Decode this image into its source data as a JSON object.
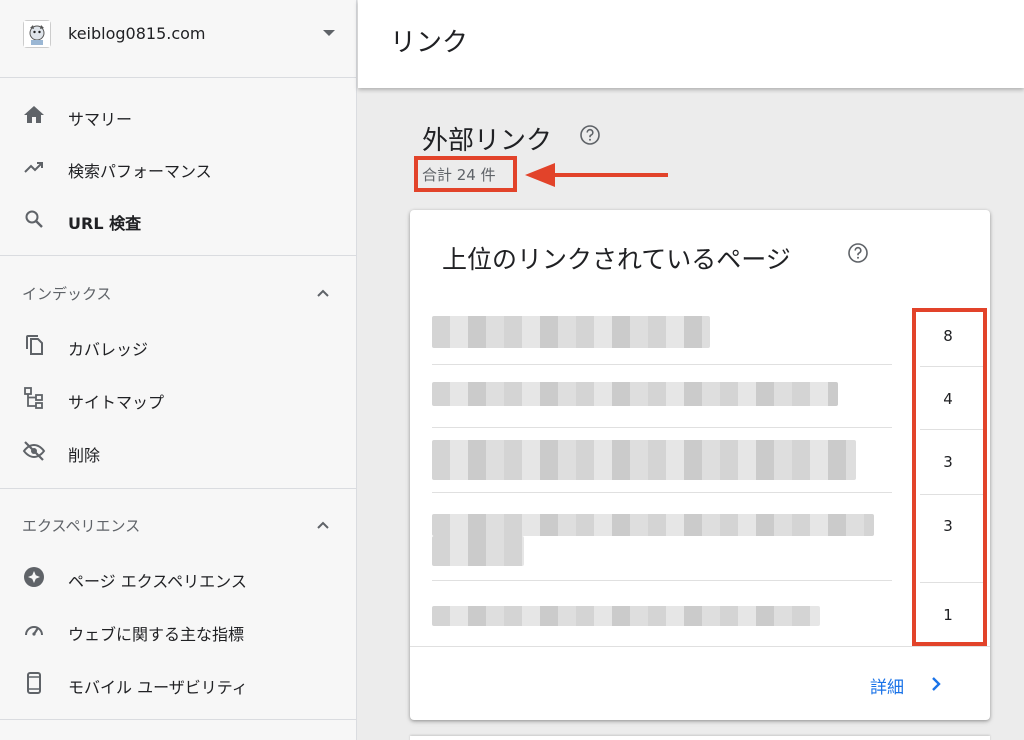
{
  "sidebar": {
    "property": "keiblog0815.com",
    "items": [
      {
        "label": "サマリー",
        "icon": "home-icon"
      },
      {
        "label": "検索パフォーマンス",
        "icon": "trending-up-icon"
      },
      {
        "label": "URL 検査",
        "icon": "search-icon"
      }
    ],
    "sections": [
      {
        "title": "インデックス",
        "items": [
          {
            "label": "カバレッジ",
            "icon": "copy-icon"
          },
          {
            "label": "サイトマップ",
            "icon": "sitemap-icon"
          },
          {
            "label": "削除",
            "icon": "eye-off-icon"
          }
        ]
      },
      {
        "title": "エクスペリエンス",
        "items": [
          {
            "label": "ページ エクスペリエンス",
            "icon": "star-badge-icon"
          },
          {
            "label": "ウェブに関する主な指標",
            "icon": "speed-icon"
          },
          {
            "label": "モバイル ユーザビリティ",
            "icon": "smartphone-icon"
          }
        ]
      }
    ]
  },
  "header": {
    "title": "リンク"
  },
  "external": {
    "title": "外部リンク",
    "total": "合計 24 件"
  },
  "card": {
    "title": "上位のリンクされているページ",
    "counts": [
      "8",
      "4",
      "3",
      "3",
      "1"
    ],
    "detail_label": "詳細"
  },
  "colors": {
    "highlight": "#e2432a",
    "link": "#1a73e8"
  }
}
